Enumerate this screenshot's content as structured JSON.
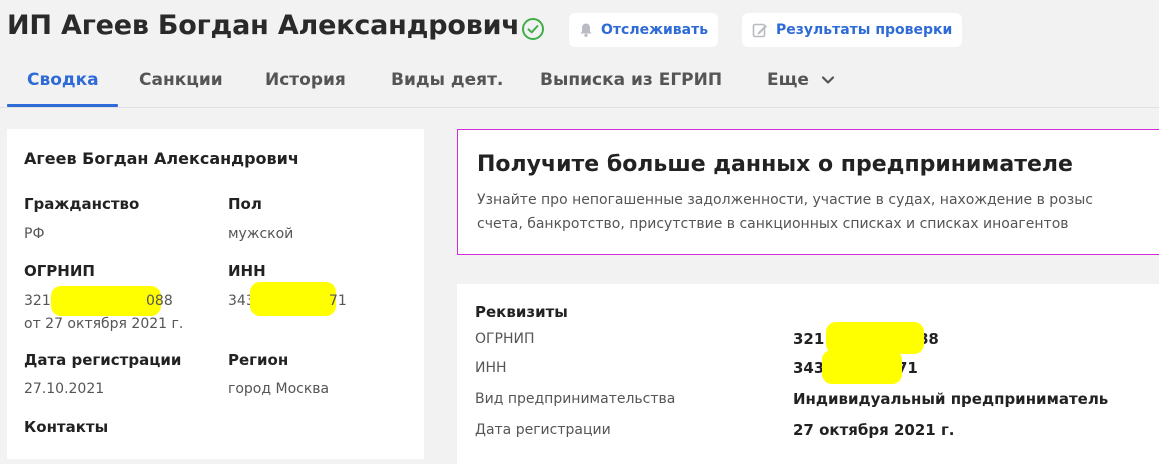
{
  "header": {
    "title": "ИП Агеев Богдан Александрович",
    "status_icon": "check-circle-icon",
    "track_button": "Отслеживать",
    "results_button": "Результаты проверки"
  },
  "tabs": [
    {
      "label": "Сводка",
      "active": true
    },
    {
      "label": "Санкции"
    },
    {
      "label": "История"
    },
    {
      "label": "Виды деят."
    },
    {
      "label": "Выписка из ЕГРИП"
    },
    {
      "label": "Еще"
    }
  ],
  "summary": {
    "name": "Агеев Богдан Александрович",
    "citizenship_label": "Гражданство",
    "citizenship_value": "РФ",
    "sex_label": "Пол",
    "sex_value": "мужской",
    "ogrnip_label": "ОГРНИП",
    "ogrnip_prefix": "3217",
    "ogrnip_suffix": "088",
    "ogrnip_date": "от 27 октября 2021 г.",
    "inn_label": "ИНН",
    "inn_prefix": "343",
    "inn_suffix": "71",
    "reg_date_label": "Дата регистрации",
    "reg_date_value": "27.10.2021",
    "region_label": "Регион",
    "region_value": "город Москва",
    "contacts_label": "Контакты"
  },
  "promo": {
    "title": "Получите больше данных о предпринимателе",
    "line1": "Узнайте про непогашенные задолженности, участие в судах, нахождение в розыс",
    "line2": "счета, банкротство, присутствие в санкционных списках и списках иноагентов"
  },
  "requisites": {
    "title": "Реквизиты",
    "ogrnip_label": "ОГРНИП",
    "ogrnip_prefix": "321",
    "ogrnip_suffix": "88",
    "inn_label": "ИНН",
    "inn_prefix": "343",
    "inn_suffix": "71",
    "type_label": "Вид предпринимательства",
    "type_value": "Индивидуальный предприниматель",
    "reg_date_label": "Дата регистрации",
    "reg_date_value": "27 октября 2021 г."
  },
  "colors": {
    "accent": "#2f6bd7",
    "success": "#3fae49",
    "promo_border": "#d52bd5",
    "redaction": "#ffff00"
  }
}
